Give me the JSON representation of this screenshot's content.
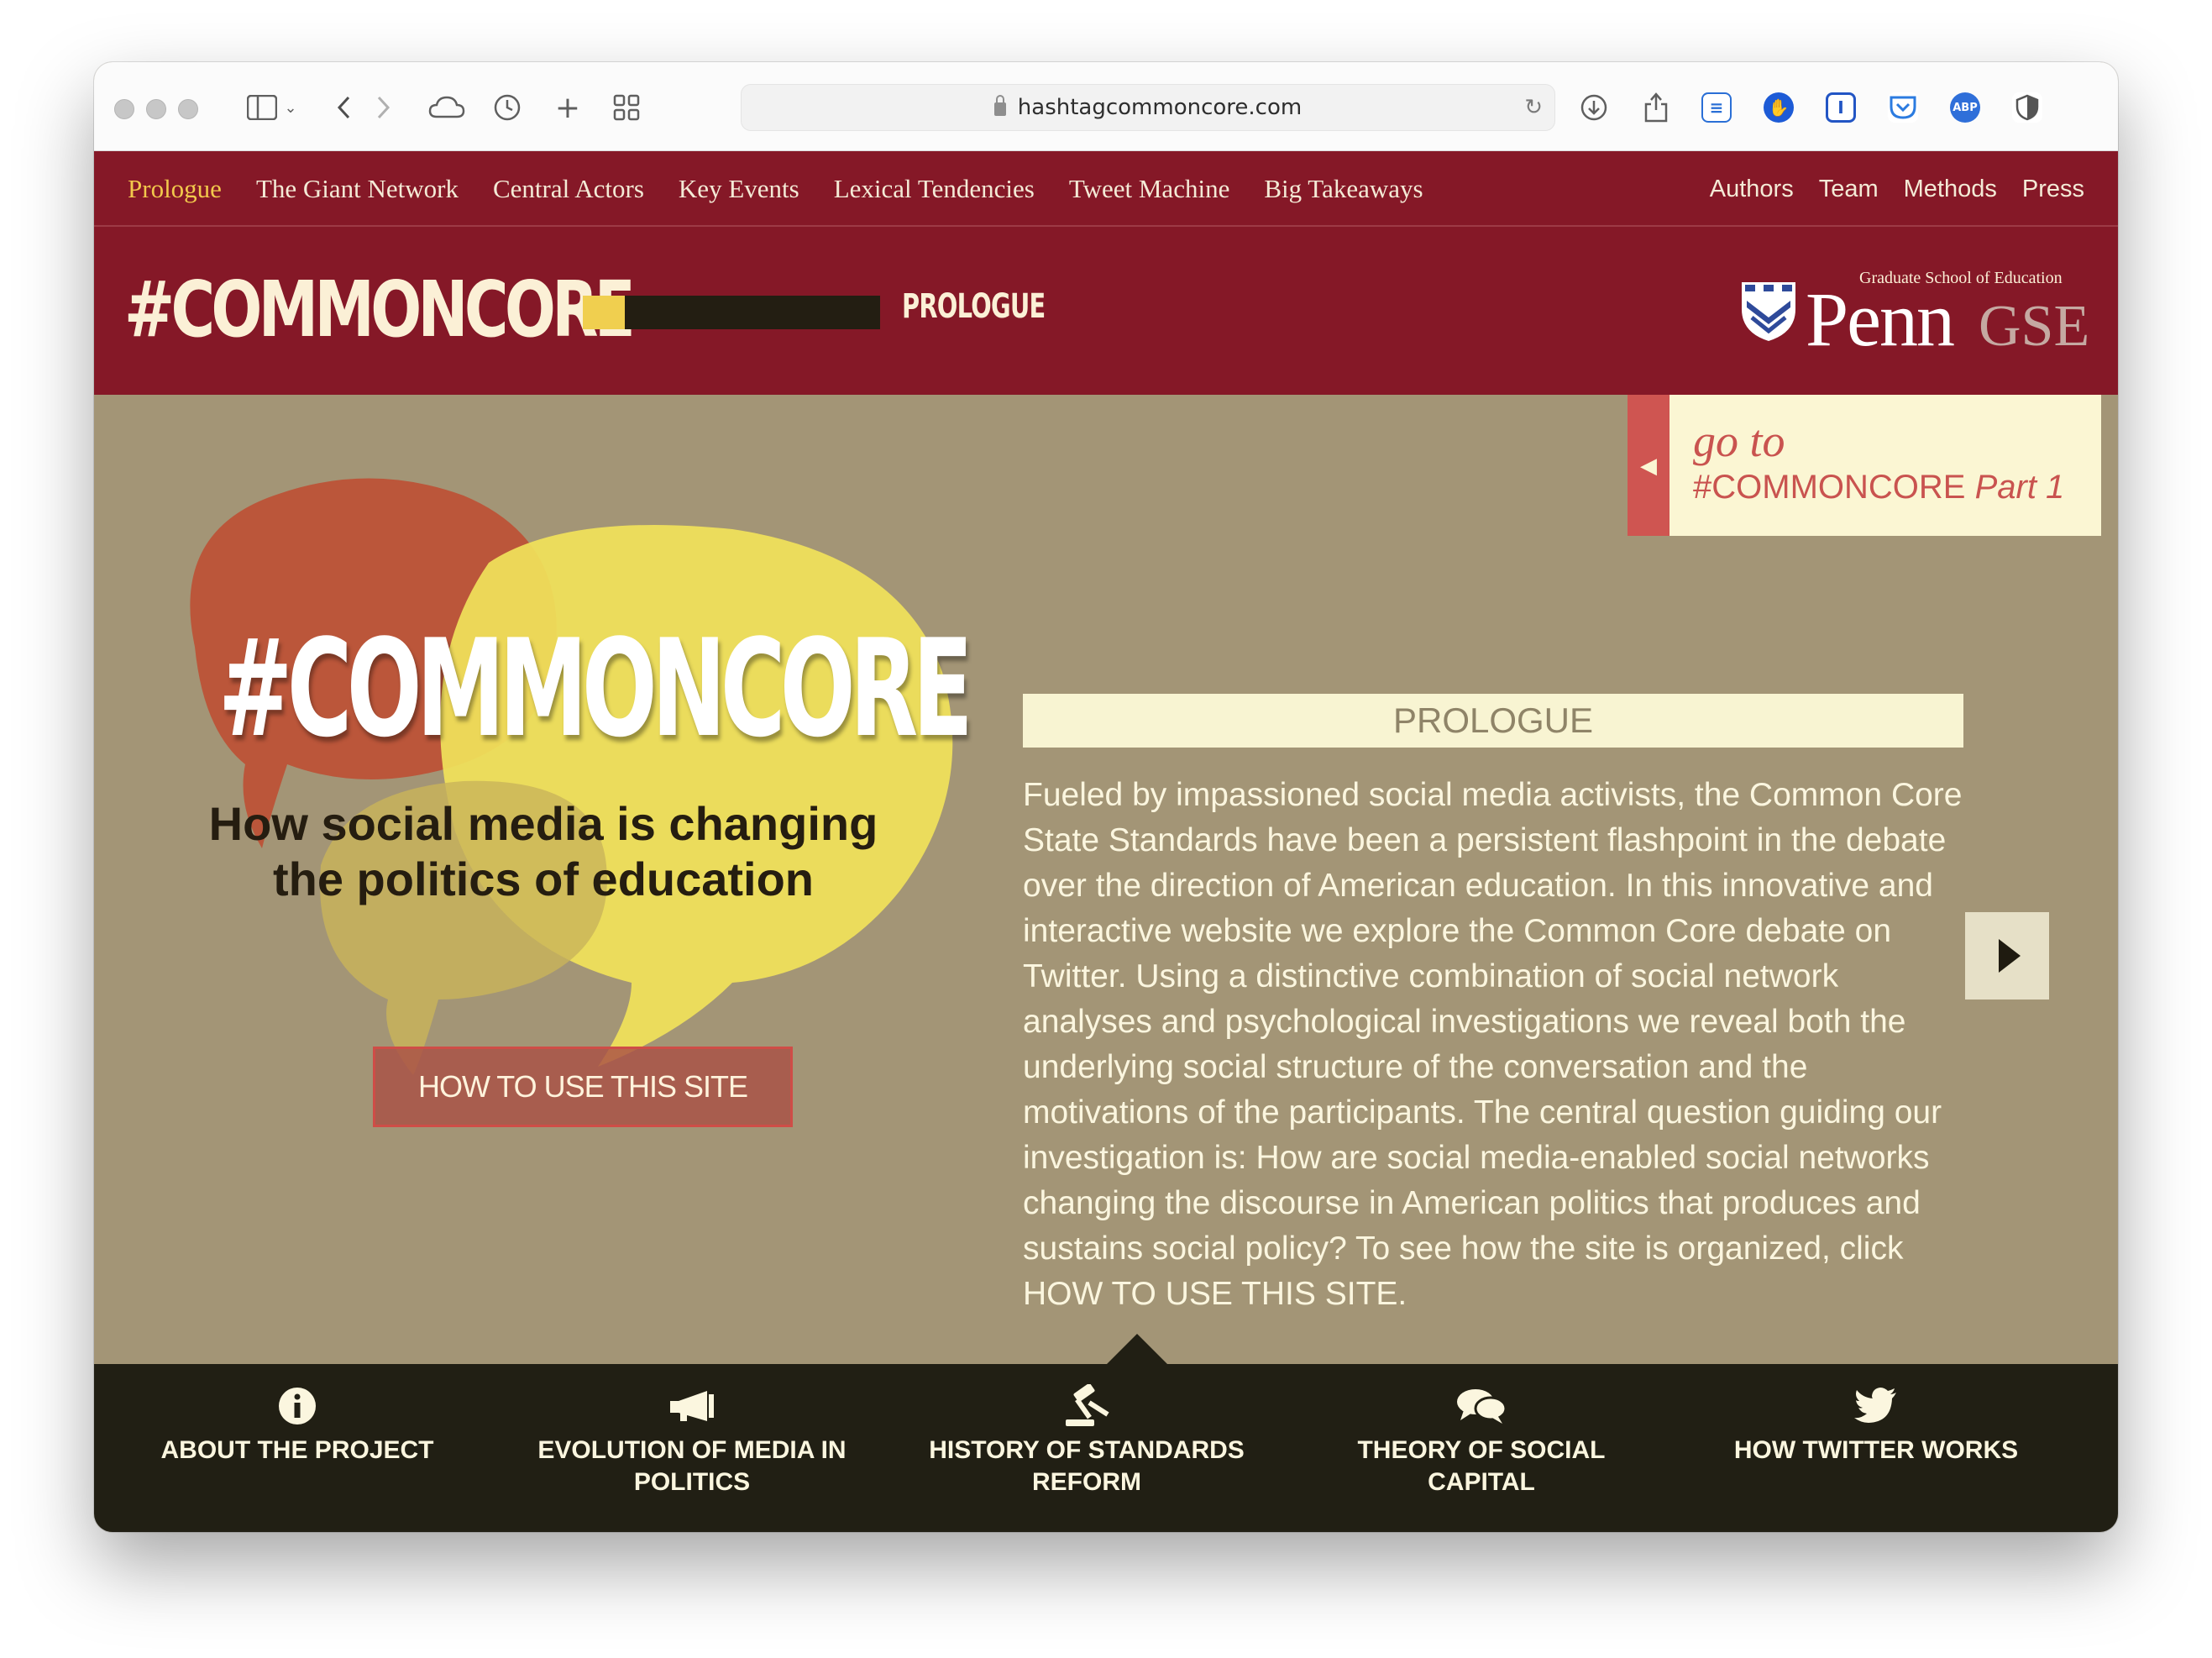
{
  "browser": {
    "url": "hashtagcommoncore.com"
  },
  "nav": {
    "left": [
      "Prologue",
      "The Giant Network",
      "Central Actors",
      "Key Events",
      "Lexical Tendencies",
      "Tweet Machine",
      "Big Takeaways"
    ],
    "right": [
      "Authors",
      "Team",
      "Methods",
      "Press"
    ],
    "active": "Prologue"
  },
  "header": {
    "logo": "#COMMONCORE",
    "section": "PROLOGUE",
    "progress": 0.14,
    "partner": {
      "top_line": "Graduate School of Education",
      "penn": "Penn",
      "gse": "GSE"
    }
  },
  "goto": {
    "line1": "go to",
    "hashtag": "#COMMONCORE",
    "part": "Part 1"
  },
  "hero": {
    "title": "#COMMONCORE",
    "subtitle": "How social media is changing the politics of education",
    "button": "HOW TO USE THIS SITE"
  },
  "prologue": {
    "heading": "PROLOGUE",
    "body": "Fueled by impassioned social media activists, the Common Core State Standards have been a persistent flashpoint in the debate over the direction of American education. In this innovative and interactive website we explore the Common Core debate on Twitter. Using a distinctive combination of social network analyses and psychological investigations we reveal both the underlying social structure of the conversation and the motivations of the participants. The central question guiding our investigation is: How are social media-enabled social networks changing the discourse in American politics that produces and sustains social policy? To see how the site is organized, click HOW TO USE THIS SITE."
  },
  "bottom": {
    "items": [
      {
        "label": "ABOUT THE PROJECT",
        "icon": "info-icon"
      },
      {
        "label": "EVOLUTION OF MEDIA IN POLITICS",
        "icon": "megaphone-icon"
      },
      {
        "label": "HISTORY OF STANDARDS REFORM",
        "icon": "gavel-icon"
      },
      {
        "label": "THEORY OF SOCIAL CAPITAL",
        "icon": "speech-bubbles-icon"
      },
      {
        "label": "HOW TWITTER WORKS",
        "icon": "twitter-bird-icon"
      }
    ]
  },
  "colors": {
    "brand": "#851827",
    "accent_yellow": "#f0cf4f",
    "background": "#a39576",
    "bottom_bar": "#211f14",
    "goto_red": "#c9534f"
  }
}
